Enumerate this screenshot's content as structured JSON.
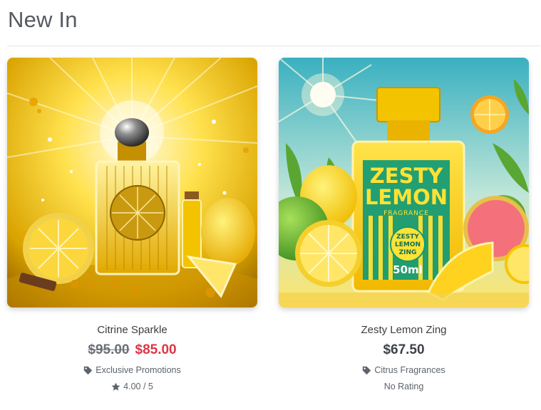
{
  "section": {
    "title": "New In"
  },
  "products": [
    {
      "name": "Citrine Sparkle",
      "old_price": "$95.00",
      "price": "$85.00",
      "category": "Exclusive Promotions",
      "rating": "4.00 / 5"
    },
    {
      "name": "Zesty Lemon Zing",
      "price": "$67.50",
      "category": "Citrus Fragrances",
      "rating": "No Rating",
      "bottle_label": {
        "line1": "ZESTY",
        "line2": "LEMON",
        "line3": "FRAGRANCE",
        "badge1": "ZESTY",
        "badge2": "LEMON",
        "badge3": "ZING",
        "volume": "50ml"
      }
    }
  ],
  "colors": {
    "sale": "#dc3545",
    "text": "#3d3d3d",
    "muted": "#5d636a"
  },
  "icons": [
    "tag-icon",
    "star-icon"
  ]
}
